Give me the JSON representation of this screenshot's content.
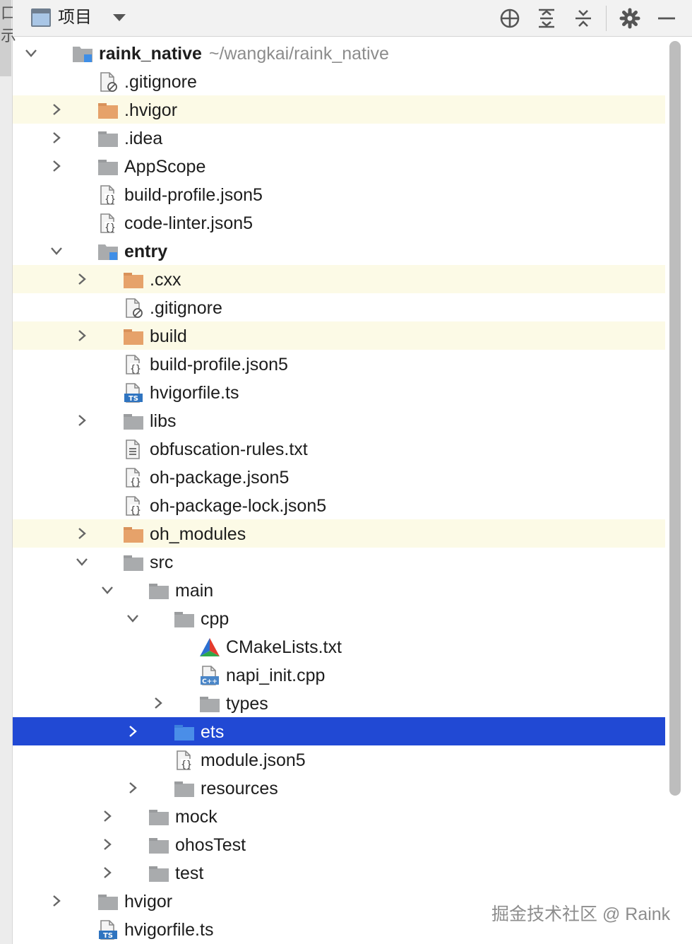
{
  "toolbar": {
    "title": "项目",
    "icons": [
      "locate-icon",
      "expand-all-icon",
      "collapse-all-icon",
      "gear-icon",
      "minimize-icon"
    ]
  },
  "side_strip": {
    "glyphs": [
      "口",
      "示"
    ]
  },
  "tree": [
    {
      "name": "raink_native",
      "path": "~/wangkai/raink_native",
      "type": "module",
      "depth": 0,
      "state": "expanded",
      "bold": true
    },
    {
      "name": ".gitignore",
      "type": "ignore",
      "depth": 1
    },
    {
      "name": ".hvigor",
      "type": "folder-orange",
      "depth": 1,
      "state": "collapsed",
      "highlight": true
    },
    {
      "name": ".idea",
      "type": "folder",
      "depth": 1,
      "state": "collapsed"
    },
    {
      "name": "AppScope",
      "type": "folder",
      "depth": 1,
      "state": "collapsed"
    },
    {
      "name": "build-profile.json5",
      "type": "json",
      "depth": 1
    },
    {
      "name": "code-linter.json5",
      "type": "json",
      "depth": 1
    },
    {
      "name": "entry",
      "type": "module",
      "depth": 1,
      "state": "expanded",
      "bold": true
    },
    {
      "name": ".cxx",
      "type": "folder-orange",
      "depth": 2,
      "state": "collapsed",
      "highlight": true
    },
    {
      "name": ".gitignore",
      "type": "ignore",
      "depth": 2
    },
    {
      "name": "build",
      "type": "folder-orange",
      "depth": 2,
      "state": "collapsed",
      "highlight": true
    },
    {
      "name": "build-profile.json5",
      "type": "json",
      "depth": 2
    },
    {
      "name": "hvigorfile.ts",
      "type": "ts",
      "depth": 2
    },
    {
      "name": "libs",
      "type": "folder",
      "depth": 2,
      "state": "collapsed"
    },
    {
      "name": "obfuscation-rules.txt",
      "type": "txt",
      "depth": 2
    },
    {
      "name": "oh-package.json5",
      "type": "json",
      "depth": 2
    },
    {
      "name": "oh-package-lock.json5",
      "type": "json",
      "depth": 2
    },
    {
      "name": "oh_modules",
      "type": "folder-orange",
      "depth": 2,
      "state": "collapsed",
      "highlight": true
    },
    {
      "name": "src",
      "type": "folder",
      "depth": 2,
      "state": "expanded"
    },
    {
      "name": "main",
      "type": "folder",
      "depth": 3,
      "state": "expanded"
    },
    {
      "name": "cpp",
      "type": "folder",
      "depth": 4,
      "state": "expanded"
    },
    {
      "name": "CMakeLists.txt",
      "type": "cmake",
      "depth": 5
    },
    {
      "name": "napi_init.cpp",
      "type": "cpp",
      "depth": 5
    },
    {
      "name": "types",
      "type": "folder",
      "depth": 5,
      "state": "collapsed"
    },
    {
      "name": "ets",
      "type": "folder-blue",
      "depth": 4,
      "state": "collapsed",
      "selected": true
    },
    {
      "name": "module.json5",
      "type": "json",
      "depth": 4
    },
    {
      "name": "resources",
      "type": "folder",
      "depth": 4,
      "state": "collapsed"
    },
    {
      "name": "mock",
      "type": "folder",
      "depth": 3,
      "state": "collapsed"
    },
    {
      "name": "ohosTest",
      "type": "folder",
      "depth": 3,
      "state": "collapsed"
    },
    {
      "name": "test",
      "type": "folder",
      "depth": 3,
      "state": "collapsed"
    },
    {
      "name": "hvigor",
      "type": "folder",
      "depth": 1,
      "state": "collapsed"
    },
    {
      "name": "hvigorfile.ts",
      "type": "ts",
      "depth": 1
    }
  ],
  "watermark": "掘金技术社区 @ Raink",
  "colors": {
    "selection": "#2149d4",
    "highlight_row": "#fcfae6",
    "folder_gray": "#a9abad",
    "folder_orange": "#e6a26a",
    "folder_blue": "#4a8ee8"
  }
}
